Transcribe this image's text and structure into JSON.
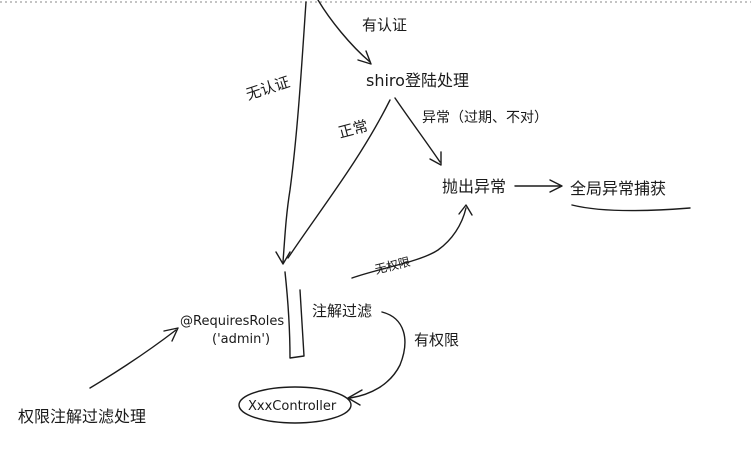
{
  "labels": {
    "has_auth": "有认证",
    "no_auth": "无认证",
    "shiro": "shiro登陆处理",
    "normal": "正常",
    "exception": "异常（过期、不对）",
    "throw_exception": "抛出异常",
    "global_catch": "全局异常捕获",
    "no_permission": "无权限",
    "annotation_filter": "注解过滤",
    "has_permission": "有权限",
    "requires_roles_line1": "@RequiresRoles",
    "requires_roles_line2": "('admin')",
    "controller": "XxxController",
    "permission_annotation": "权限注解过滤处理"
  }
}
